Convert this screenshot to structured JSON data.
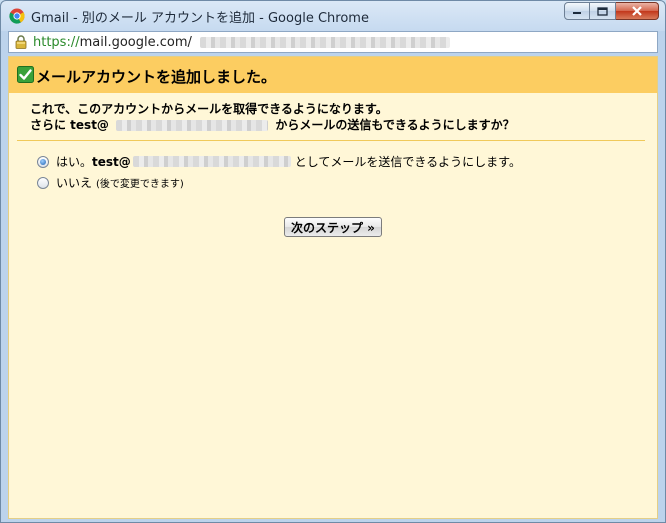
{
  "window": {
    "title": "Gmail - 別のメール アカウントを追加 - Google Chrome",
    "controls": {
      "minimize": "",
      "maximize": "",
      "close": ""
    }
  },
  "urlbar": {
    "scheme": "https://",
    "host": "mail.google.com/"
  },
  "dialog": {
    "header": "メールアカウントを追加しました。",
    "desc_line1": "これで、このアカウントからメールを取得できるようになります。",
    "desc_line2_pre": "さらに test@",
    "desc_line2_post": "からメールの送信もできるようにしますか？",
    "option_yes_label": "はい。",
    "option_yes_email": "test@",
    "option_yes_suffix": "としてメールを送信できるようにします。",
    "option_no_label": "いいえ",
    "option_no_note": "(後で変更できます)",
    "next_button": "次のステップ »"
  },
  "colors": {
    "header_bg": "#fccd61",
    "content_bg": "#fff7d7",
    "https_green": "#2b8a2b"
  },
  "icons": {
    "title": "chrome-icon",
    "lock": "lock-icon",
    "header": "checkmark-icon"
  },
  "state": {
    "selected_option": "yes"
  }
}
